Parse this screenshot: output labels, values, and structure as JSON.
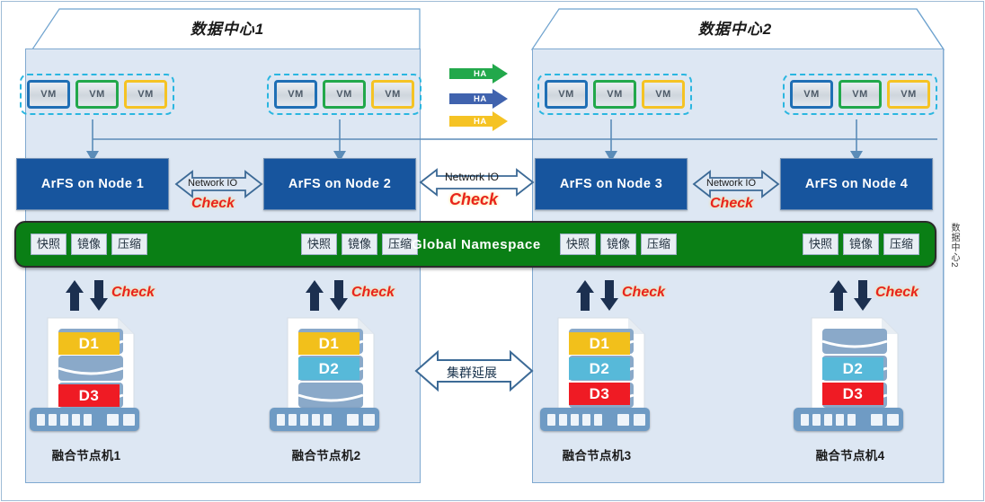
{
  "diagram": {
    "datacenters": [
      {
        "title": "数据中心1"
      },
      {
        "title": "数据中心2"
      }
    ],
    "side_label": "数据中心2",
    "vm_label": "VM",
    "vm_groups": [
      {
        "vms": [
          "VM",
          "VM",
          "VM"
        ]
      },
      {
        "vms": [
          "VM",
          "VM",
          "VM"
        ]
      },
      {
        "vms": [
          "VM",
          "VM",
          "VM"
        ]
      },
      {
        "vms": [
          "VM",
          "VM",
          "VM"
        ]
      }
    ],
    "nodes": [
      {
        "label": "ArFS on  Node 1"
      },
      {
        "label": "ArFS on  Node 2"
      },
      {
        "label": "ArFS on  Node 3"
      },
      {
        "label": "ArFS on  Node 4"
      }
    ],
    "ha_arrows": [
      {
        "label": "HA",
        "color": "#22a84b"
      },
      {
        "label": "HA",
        "color": "#4063ae"
      },
      {
        "label": "HA",
        "color": "#f5c324"
      }
    ],
    "network_io_links": [
      {
        "label": "Network IO",
        "check": "Check"
      },
      {
        "label": "Network IO",
        "check": "Check"
      },
      {
        "label": "Network IO",
        "check": "Check"
      }
    ],
    "global_namespace": {
      "label": "Global  Namespace",
      "chip_sets": [
        {
          "chips": [
            "快照",
            "镜像",
            "压缩"
          ]
        },
        {
          "chips": [
            "快照",
            "镜像",
            "压缩"
          ]
        },
        {
          "chips": [
            "快照",
            "镜像",
            "压缩"
          ]
        },
        {
          "chips": [
            "快照",
            "镜像",
            "压缩"
          ]
        }
      ]
    },
    "cluster_extension": {
      "label": "集群延展"
    },
    "check_label": "Check",
    "servers": [
      {
        "name": "融合节点机1",
        "disks": [
          {
            "id": "D1",
            "color": "#f2c01b",
            "slot": 0
          },
          {
            "id": "D3",
            "color": "#ef1b24",
            "slot": 2
          }
        ]
      },
      {
        "name": "融合节点机2",
        "disks": [
          {
            "id": "D1",
            "color": "#f2c01b",
            "slot": 0
          },
          {
            "id": "D2",
            "color": "#57b9d9",
            "slot": 1
          }
        ]
      },
      {
        "name": "融合节点机3",
        "disks": [
          {
            "id": "D1",
            "color": "#f2c01b",
            "slot": 0
          },
          {
            "id": "D2",
            "color": "#57b9d9",
            "slot": 1
          },
          {
            "id": "D3",
            "color": "#ef1b24",
            "slot": 2
          }
        ]
      },
      {
        "name": "融合节点机4",
        "disks": [
          {
            "id": "D2",
            "color": "#57b9d9",
            "slot": 1
          },
          {
            "id": "D3",
            "color": "#ef1b24",
            "slot": 2
          }
        ]
      }
    ],
    "colors": {
      "datacenter_fill": "#dde7f3",
      "node_fill": "#17559e",
      "namespace_fill": "#0a7f15",
      "vm_blue": "#1f6fb5",
      "vm_green": "#22a84b",
      "vm_yellow": "#f5c324",
      "check_red": "#e8241c",
      "arrow_blue": "#5b8cb8",
      "disk_body": "#8aa9c9"
    }
  }
}
